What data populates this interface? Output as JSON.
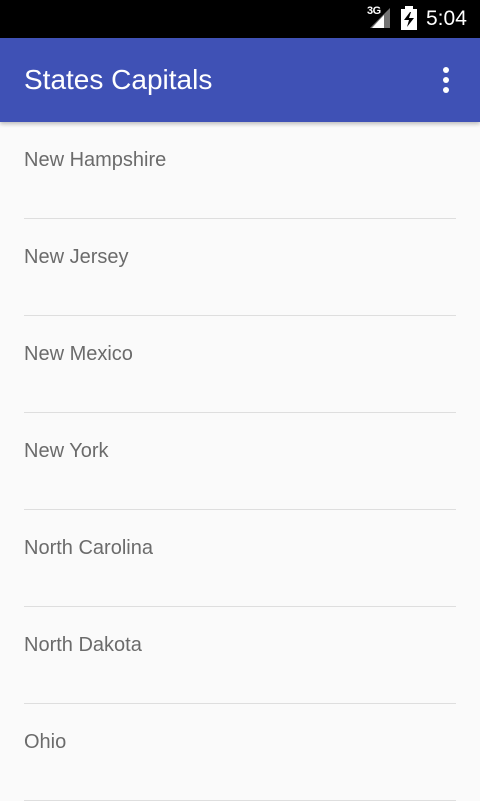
{
  "status_bar": {
    "network": "3G",
    "time": "5:04",
    "icons": [
      "signal-icon",
      "battery-charging-icon"
    ]
  },
  "app_bar": {
    "title": "States Capitals",
    "overflow_icon": "more-vert-icon",
    "color": "#3f51b5"
  },
  "states": [
    {
      "name": "New Hampshire"
    },
    {
      "name": "New Jersey"
    },
    {
      "name": "New Mexico"
    },
    {
      "name": "New York"
    },
    {
      "name": "North Carolina"
    },
    {
      "name": "North Dakota"
    },
    {
      "name": "Ohio"
    }
  ]
}
